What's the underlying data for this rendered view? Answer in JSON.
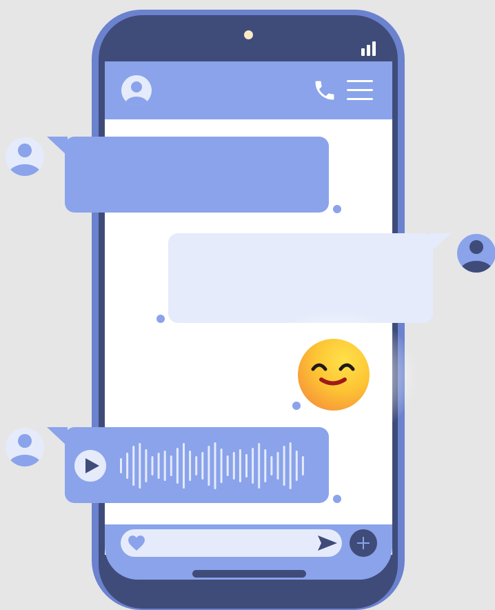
{
  "app": {
    "type": "chat messenger illustration"
  },
  "colors": {
    "background": "#e6e6e6",
    "phone_frame": "#3f4c79",
    "phone_edge": "#6b82cf",
    "accent_blue": "#8aa3ea",
    "light_bubble": "#e5ebfb",
    "emoji_yellow": "#fdd034",
    "emoji_orange": "#f7a53a",
    "emoji_mouth": "#9e1a1a"
  },
  "status_bar": {
    "icons": [
      "camera-dot",
      "signal-bars-icon"
    ]
  },
  "header": {
    "icons": [
      "contact-avatar-icon",
      "phone-call-icon",
      "hamburger-menu-icon"
    ]
  },
  "messages": [
    {
      "sender": "contact",
      "type": "text",
      "text": "",
      "avatar": "user-avatar-icon"
    },
    {
      "sender": "self",
      "type": "text",
      "text": "",
      "avatar": "user-avatar-icon"
    },
    {
      "sender": "self",
      "type": "emoji",
      "emoji": "smiling-face"
    },
    {
      "sender": "contact",
      "type": "voice",
      "avatar": "user-avatar-icon",
      "controls": [
        "play-icon",
        "waveform"
      ]
    }
  ],
  "composer": {
    "input_value": "",
    "icons": [
      "heart-icon",
      "send-icon",
      "plus-icon"
    ]
  }
}
